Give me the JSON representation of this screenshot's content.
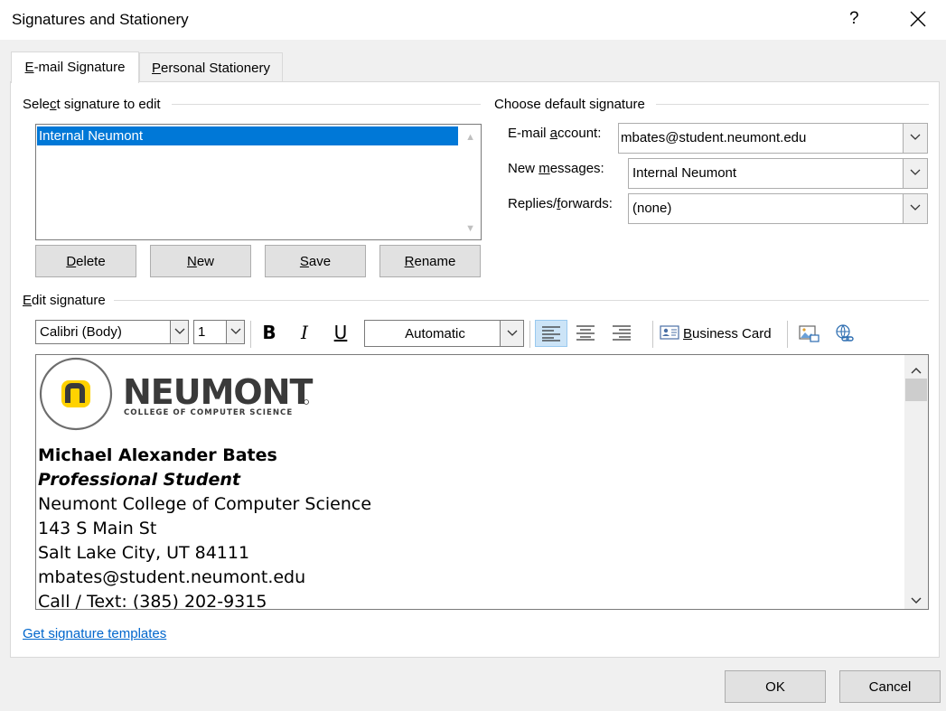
{
  "window": {
    "title": "Signatures and Stationery",
    "help": "?"
  },
  "tabs": [
    {
      "label": "E-mail Signature",
      "mnemonic": "E",
      "rest": "-mail Signature"
    },
    {
      "label": "Personal Stationery",
      "mnemonic": "P",
      "rest": "ersonal Stationery"
    }
  ],
  "select_section": {
    "label_pre": "Sele",
    "label_mn": "c",
    "label_post": "t signature to edit",
    "items": [
      "Internal Neumont"
    ],
    "buttons": {
      "delete": {
        "mn": "D",
        "rest": "elete"
      },
      "new": {
        "mn": "N",
        "rest": "ew"
      },
      "save": {
        "mn": "S",
        "rest": "ave"
      },
      "rename": {
        "mn": "R",
        "rest": "ename"
      }
    }
  },
  "default_section": {
    "label": "Choose default signature",
    "email_account_pre": "E-mail ",
    "email_account_mn": "a",
    "email_account_post": "ccount:",
    "email_account_value": "mbates@student.neumont.edu",
    "new_messages_pre": "New ",
    "new_messages_mn": "m",
    "new_messages_post": "essages:",
    "new_messages_value": "Internal Neumont",
    "replies_pre": "Replies/",
    "replies_mn": "f",
    "replies_post": "orwards:",
    "replies_value": "(none)"
  },
  "edit_section": {
    "label_mn": "E",
    "label_rest": "dit signature",
    "font": "Calibri (Body)",
    "size": "1",
    "bold": "B",
    "italic": "I",
    "underline": "U",
    "color": "Automatic",
    "business_card_mn": "B",
    "business_card_rest": "usiness Card"
  },
  "logo": {
    "wordmark": "NEUMONT",
    "tagline": "COLLEGE OF COMPUTER SCIENCE",
    "letter": "n",
    "accent_color": "#ffd200",
    "text_color": "#3a3a3a"
  },
  "signature": {
    "name": "Michael Alexander Bates",
    "role": "Professional Student",
    "org": "Neumont College of Computer Science",
    "street": "143 S Main St",
    "city": "Salt Lake City, UT 84111",
    "email": "mbates@student.neumont.edu",
    "phone": "Call / Text: (385) 202-9315"
  },
  "templates_link": "Get signature templates",
  "footer": {
    "ok": "OK",
    "cancel": "Cancel"
  }
}
